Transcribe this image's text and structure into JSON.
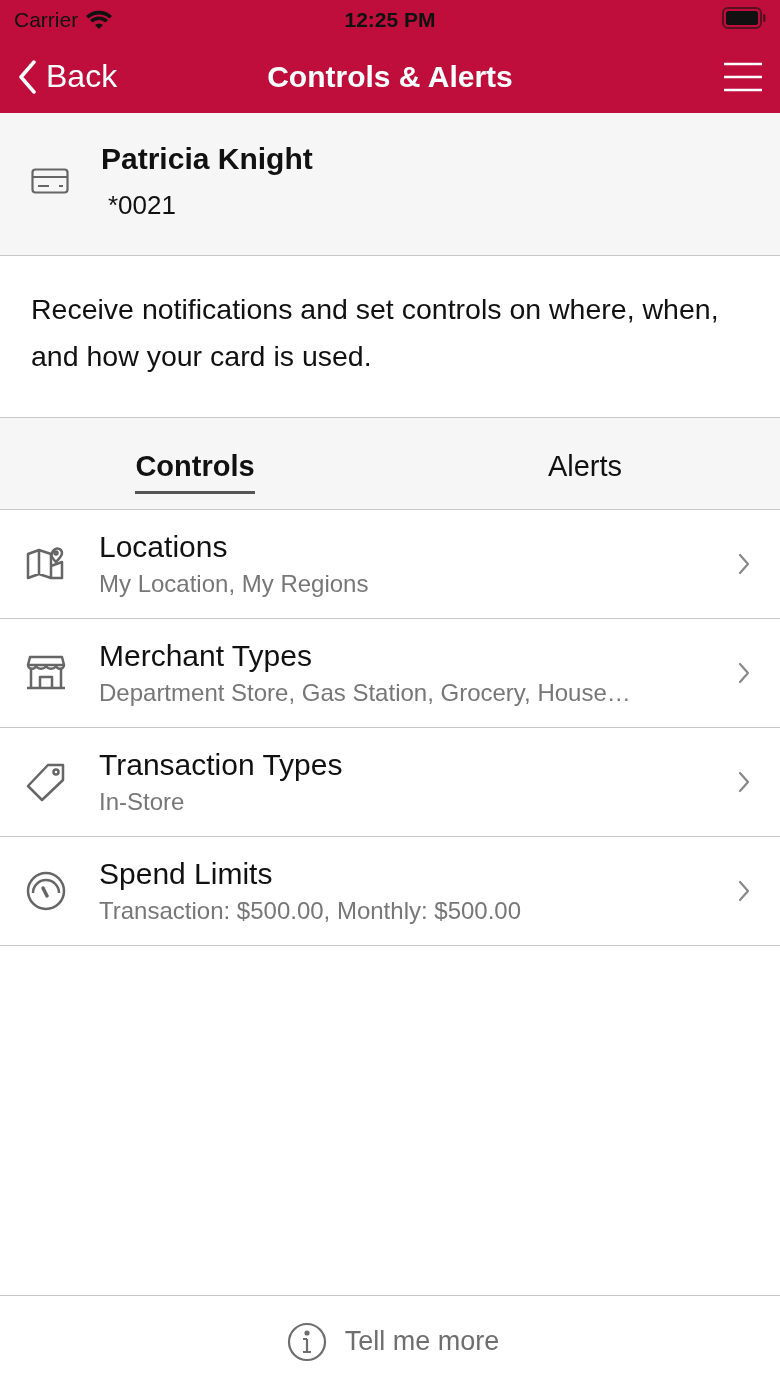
{
  "status_bar": {
    "carrier": "Carrier",
    "time": "12:25 PM"
  },
  "nav_bar": {
    "back_label": "Back",
    "title": "Controls & Alerts"
  },
  "card": {
    "holder": "Patricia Knight",
    "number": "*0021"
  },
  "description": "Receive notifications and set controls on where, when, and how your card is used.",
  "tabs": [
    {
      "label": "Controls",
      "selected": true
    },
    {
      "label": "Alerts",
      "selected": false
    }
  ],
  "controls": [
    {
      "kind": "map",
      "title": "Locations",
      "subtitle": "My Location, My Regions"
    },
    {
      "kind": "store",
      "title": "Merchant Types",
      "subtitle": "Department Store, Gas Station, Grocery, House…"
    },
    {
      "kind": "tag",
      "title": "Transaction Types",
      "subtitle": "In-Store"
    },
    {
      "kind": "gauge",
      "title": "Spend Limits",
      "subtitle": "Transaction: $500.00, Monthly: $500.00"
    }
  ],
  "footer": {
    "link": "Tell me more"
  }
}
